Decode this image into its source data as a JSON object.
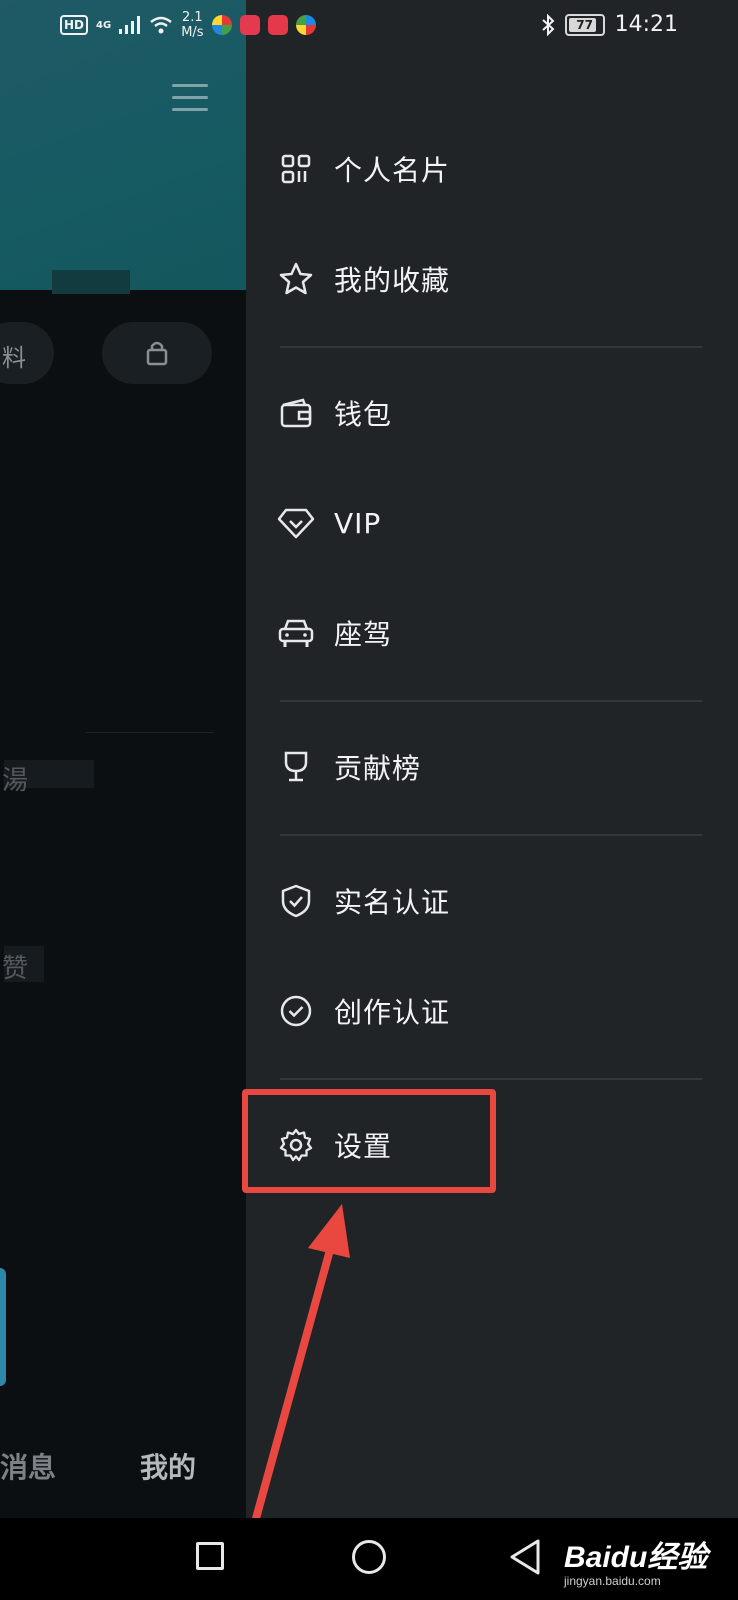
{
  "status_bar": {
    "hd": "HD",
    "network": "4G",
    "speed_value": "2.1",
    "speed_unit": "M/s",
    "battery": "77",
    "time": "14:21"
  },
  "background_page": {
    "pill_text": "料",
    "blur_text_1": "湯",
    "blur_text_2": "赞",
    "tab_messages": "消息",
    "tab_mine": "我的"
  },
  "drawer": {
    "items": [
      {
        "label": "个人名片",
        "icon": "qr-card-icon"
      },
      {
        "label": "我的收藏",
        "icon": "star-icon"
      },
      {
        "label": "钱包",
        "icon": "wallet-icon"
      },
      {
        "label": "VIP",
        "icon": "diamond-icon"
      },
      {
        "label": "座驾",
        "icon": "car-icon"
      },
      {
        "label": "贡献榜",
        "icon": "trophy-icon"
      },
      {
        "label": "实名认证",
        "icon": "shield-check-icon"
      },
      {
        "label": "创作认证",
        "icon": "check-circle-icon"
      },
      {
        "label": "设置",
        "icon": "gear-icon"
      }
    ]
  },
  "annotation": {
    "highlight_color": "#e8483f"
  },
  "watermark": {
    "brand": "Baidu经验",
    "url": "jingyan.baidu.com"
  }
}
